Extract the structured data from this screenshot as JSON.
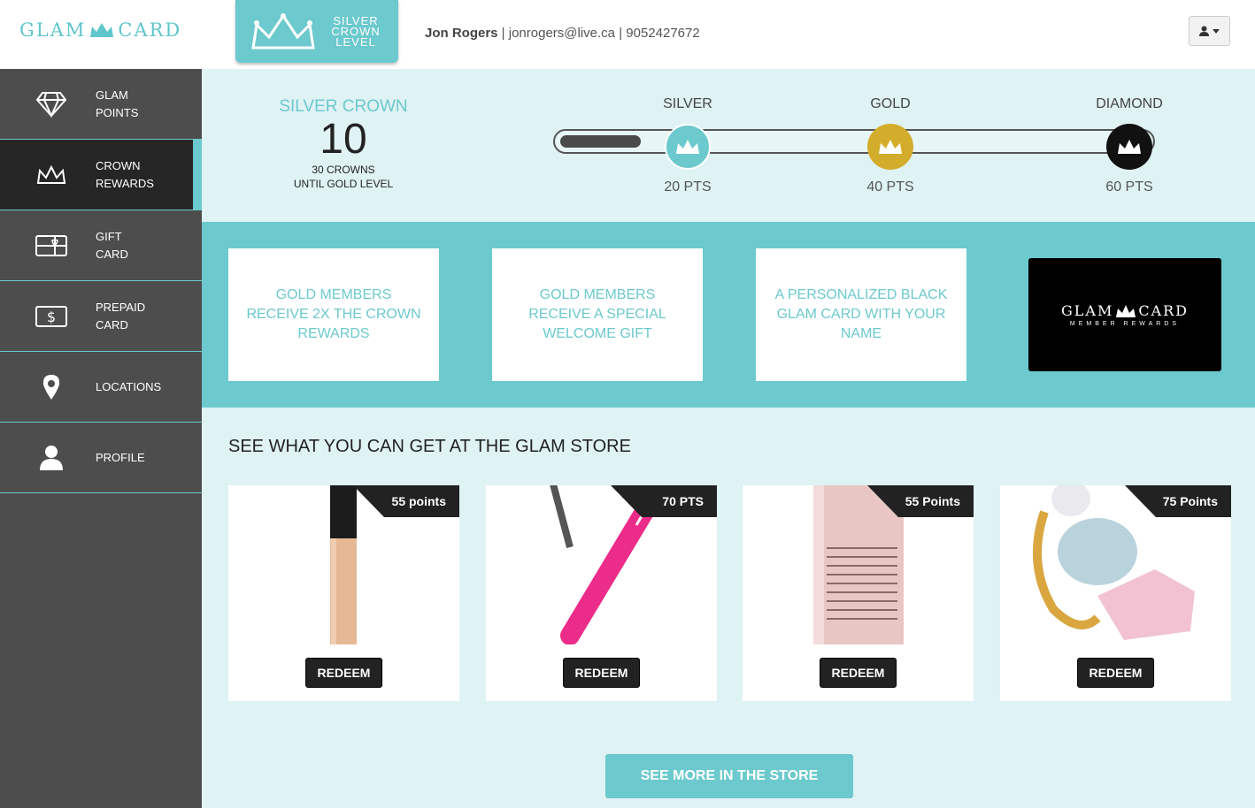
{
  "brand": {
    "logo_left": "GLAM",
    "logo_right": "CARD",
    "accent": "#6cc9cd"
  },
  "level_badge": {
    "line1": "SILVER",
    "line2": "CROWN",
    "line3": "LEVEL"
  },
  "user": {
    "name": "Jon Rogers",
    "sep1": " | ",
    "email": "jonrogers@live.ca",
    "sep2": " | ",
    "phone": "9052427672"
  },
  "sidebar": {
    "items": [
      {
        "line1": "GLAM",
        "line2": "POINTS",
        "icon": "diamond-icon"
      },
      {
        "line1": "CROWN",
        "line2": "REWARDS",
        "icon": "crown-icon"
      },
      {
        "line1": "GIFT",
        "line2": "CARD",
        "icon": "gift-card-icon"
      },
      {
        "line1": "PREPAID",
        "line2": "CARD",
        "icon": "dollar-card-icon"
      },
      {
        "line1": "LOCATIONS",
        "line2": "",
        "icon": "location-pin-icon"
      },
      {
        "line1": "PROFILE",
        "line2": "",
        "icon": "user-icon"
      }
    ]
  },
  "crown_status": {
    "level": "SILVER CROWN",
    "count": "10",
    "until1": "30 CROWNS",
    "until2": "UNTIL GOLD LEVEL"
  },
  "tiers": [
    {
      "name": "SILVER",
      "pts": "20 PTS",
      "color": "#6cc9cd"
    },
    {
      "name": "GOLD",
      "pts": "40 PTS",
      "color": "#d4ac2b"
    },
    {
      "name": "DIAMOND",
      "pts": "60 PTS",
      "color": "#111111"
    }
  ],
  "benefits": [
    "GOLD MEMBERS RECEIVE 2X THE CROWN REWARDS",
    "GOLD MEMBERS RECEIVE A SPECIAL WELCOME GIFT",
    "A PERSONALIZED BLACK GLAM CARD WITH YOUR NAME"
  ],
  "black_card": {
    "left": "GLAM",
    "right": "CARD",
    "sub": "MEMBER REWARDS"
  },
  "store": {
    "title": "SEE WHAT YOU CAN GET AT THE GLAM STORE",
    "products": [
      {
        "points": "55 points",
        "redeem": "REDEEM"
      },
      {
        "points": "70 PTS",
        "redeem": "REDEEM"
      },
      {
        "points": "55 Points",
        "redeem": "REDEEM"
      },
      {
        "points": "75 Points",
        "redeem": "REDEEM"
      }
    ],
    "see_more": "SEE MORE IN THE STORE"
  }
}
